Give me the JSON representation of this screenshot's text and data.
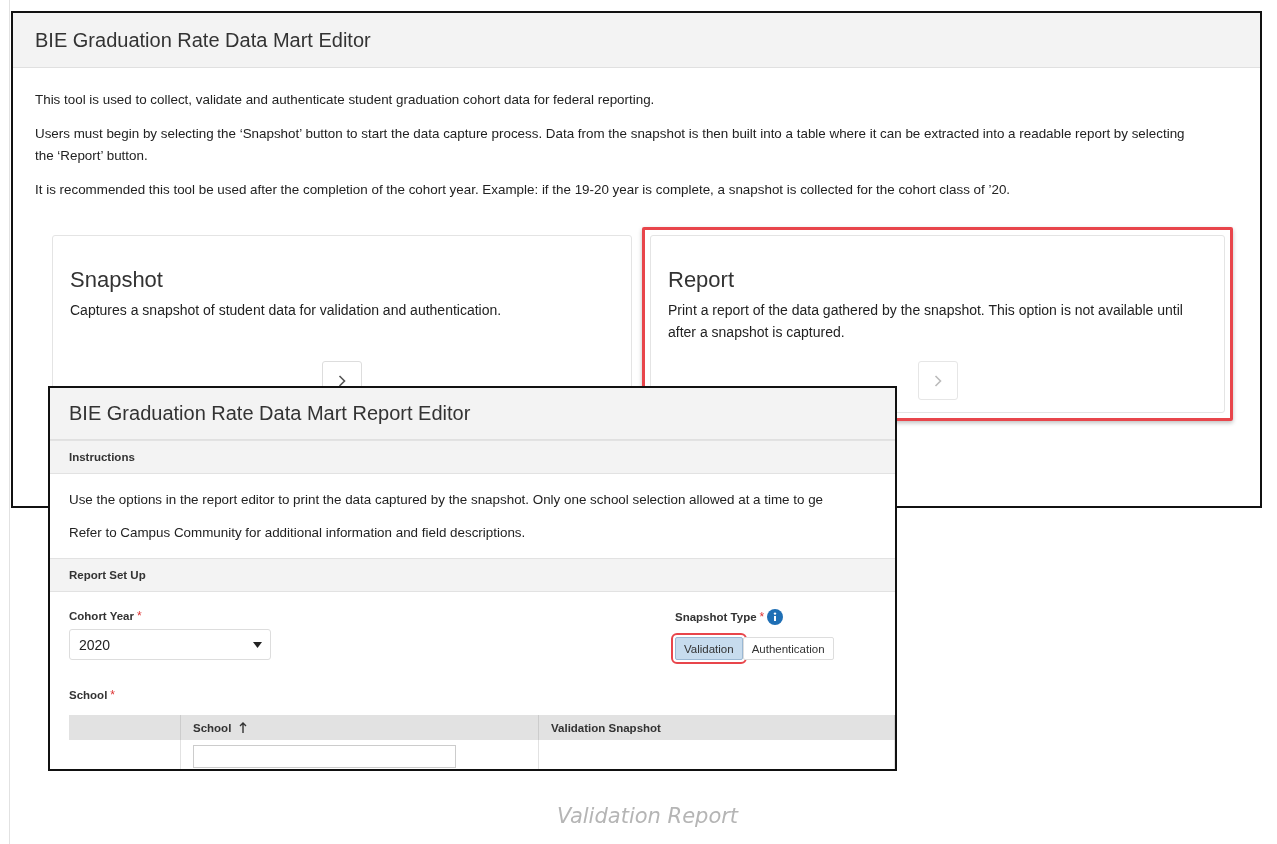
{
  "main_window": {
    "title": "BIE Graduation Rate Data Mart Editor",
    "paragraphs": [
      "This tool is used to collect, validate and authenticate student graduation cohort data for federal reporting.",
      "Users must begin by selecting the ‘Snapshot’ button to start the data capture process. Data from the snapshot is then built into a table where it can be extracted into a readable report by selecting the ‘Report’ button.",
      "It is recommended this tool be used after the completion of the cohort year. Example: if the 19-20 year is complete, a snapshot is collected for the cohort class of ’20."
    ],
    "cards": [
      {
        "title": "Snapshot",
        "description": "Captures a snapshot of student data for validation and authentication.",
        "highlighted": false,
        "disabled": false
      },
      {
        "title": "Report",
        "description": "Print a report of the data gathered by the snapshot. This option is not available until after a snapshot is captured.",
        "highlighted": true,
        "disabled": true
      }
    ]
  },
  "report_window": {
    "title": "BIE Graduation Rate Data Mart Report Editor",
    "instructions": {
      "heading": "Instructions",
      "lines": [
        "Use the options in the report editor to print the data captured by the snapshot. Only one school selection allowed at a time to ge",
        "Refer to Campus Community for additional information and field descriptions."
      ]
    },
    "setup": {
      "heading": "Report Set Up",
      "cohort_year": {
        "label": "Cohort Year",
        "required_mark": "*",
        "value": "2020"
      },
      "snapshot_type": {
        "label": "Snapshot Type",
        "required_mark": "*",
        "options": [
          {
            "label": "Validation",
            "selected": true,
            "highlighted": true
          },
          {
            "label": "Authentication",
            "selected": false,
            "highlighted": false
          }
        ]
      },
      "school": {
        "label": "School",
        "required_mark": "*",
        "columns": [
          {
            "kind": "blank"
          },
          {
            "kind": "text",
            "label": "School",
            "sorted": true,
            "filter": true
          },
          {
            "kind": "text",
            "label": "Validation Snapshot",
            "filter": false
          }
        ]
      }
    }
  },
  "caption": "Validation Report"
}
